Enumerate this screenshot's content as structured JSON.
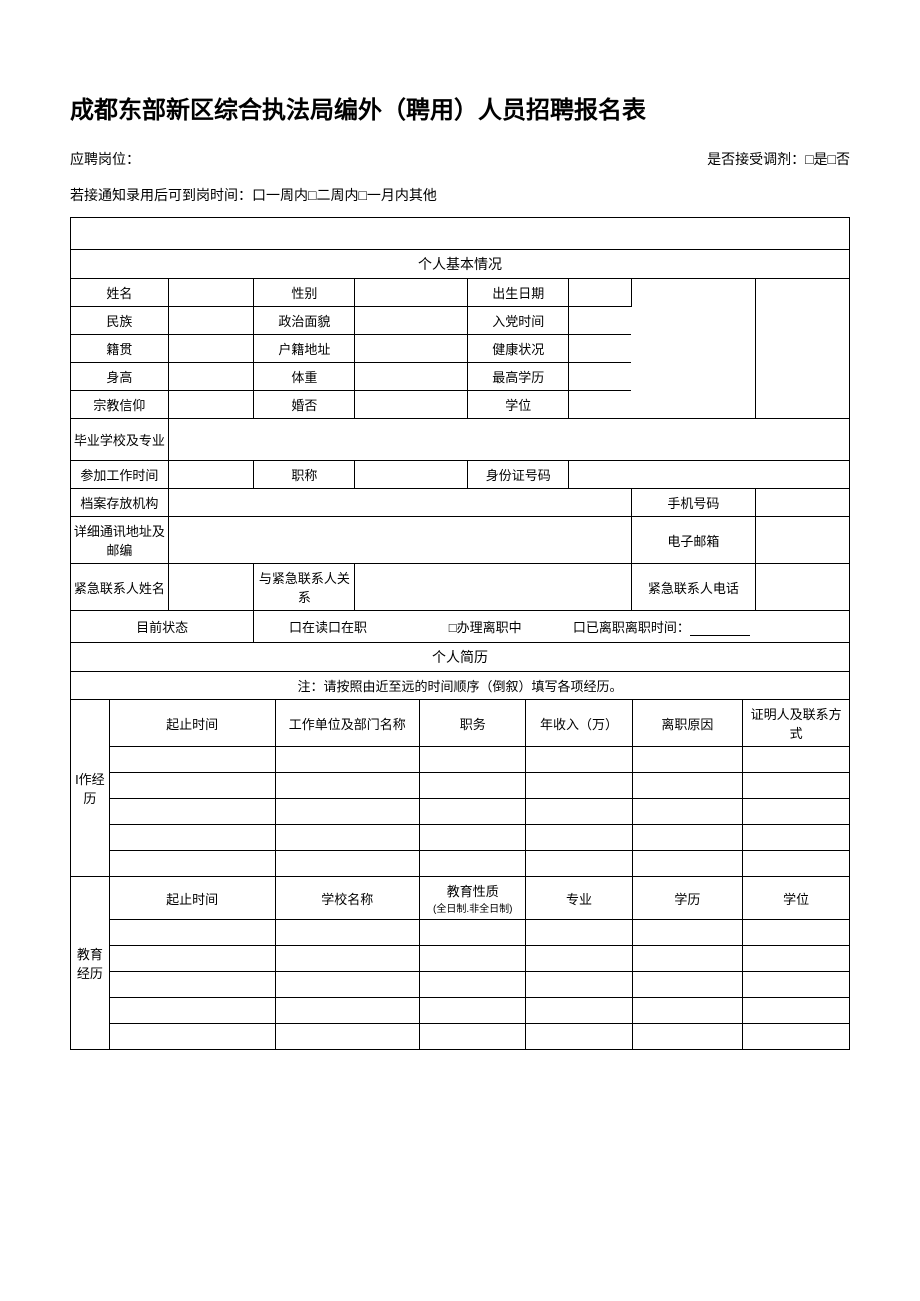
{
  "title": "成都东部新区综合执法局编外（聘用）人员招聘报名表",
  "top": {
    "position_label": "应聘岗位：",
    "transfer_label": "是否接受调剂：□是□否",
    "arrival_label": "若接通知录用后可到岗时间：口一周内□二周内□一月内其他"
  },
  "section_basic": "个人基本情况",
  "basic": {
    "name": "姓名",
    "gender": "性别",
    "birth": "出生日期",
    "ethnic": "民族",
    "political": "政治面貌",
    "party_time": "入党时间",
    "origin": "籍贯",
    "hukou": "户籍地址",
    "health": "健康状况",
    "height": "身高",
    "weight": "体重",
    "edu": "最高学历",
    "religion": "宗教信仰",
    "marriage": "婚否",
    "degree": "学位",
    "school": "毕业学校及专业",
    "work_time": "参加工作时间",
    "title": "职称",
    "id_no": "身份证号码",
    "archive": "档案存放机构",
    "phone": "手机号码",
    "address": "详细通讯地址及邮编",
    "email": "电子邮箱",
    "emerg_name": "紧急联系人姓名",
    "emerg_rel": "与紧急联系人关系",
    "emerg_phone": "紧急联系人电话"
  },
  "status": {
    "label": "目前状态",
    "opt1": "口在读口在职",
    "opt2": "□办理离职中",
    "opt3": "口已离职离职时间："
  },
  "section_resume": "个人简历",
  "note": "注：请按照由近至远的时间顺序（倒叙）填写各项经历。",
  "work": {
    "header": "I作经历",
    "period": "起止时间",
    "unit": "工作单位及部门名称",
    "job": "职务",
    "income": "年收入（万）",
    "reason": "离职原因",
    "ref": "证明人及联系方式"
  },
  "edu": {
    "header": "教育经历",
    "period": "起止时间",
    "school": "学校名称",
    "nature": "教育性质",
    "nature_sub": "(全日制.非全日制)",
    "major": "专业",
    "level": "学历",
    "degree": "学位"
  }
}
